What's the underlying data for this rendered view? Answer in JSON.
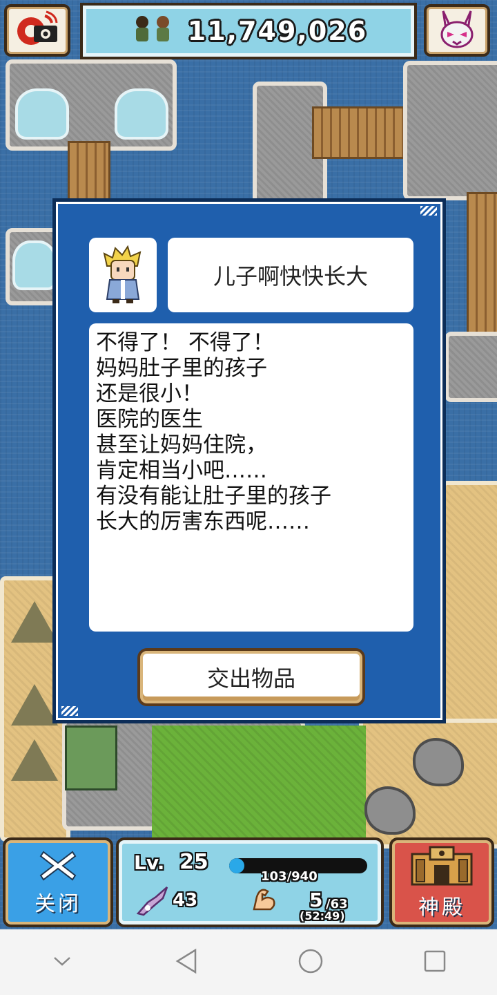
{
  "hud": {
    "money": "11,749,026",
    "camera_icon": "camera-icon",
    "rabbit_icon": "rabbit-mask-icon"
  },
  "dialog": {
    "title": "儿子啊快快长大",
    "lines": [
      "不得了！ 不得了！",
      "妈妈肚子里的孩子",
      "还是很小！",
      "医院的医生",
      "甚至让妈妈住院，",
      "肯定相当小吧……",
      "有没有能让肚子里的孩子",
      "长大的厉害东西呢……"
    ],
    "submit_label": "交出物品"
  },
  "bottom": {
    "close_label": "关闭",
    "temple_label": "神殿",
    "level_label": "Lv.",
    "level": "25",
    "exp_text": "103/940",
    "exp_fraction": 0.11,
    "attack": "43",
    "strength": "5",
    "strength_max": "/63",
    "strength_detail": "(52:49)"
  },
  "colors": {
    "dialog_bg": "#1f5fad",
    "close_button": "#3aa0e6",
    "temple_button": "#d9534a",
    "hud_bar": "#8fd3e6"
  }
}
